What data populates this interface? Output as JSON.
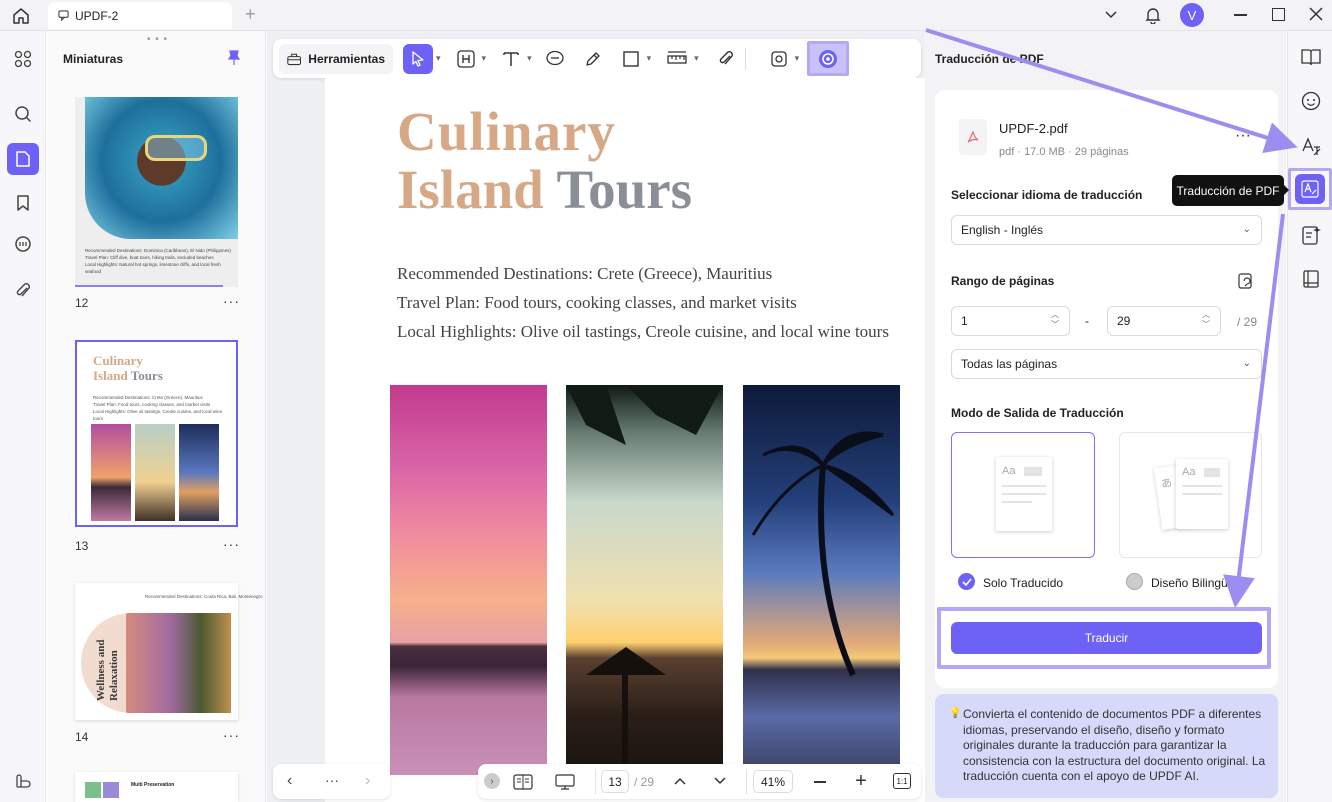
{
  "window": {
    "tab_title": "UPDF-2",
    "user_initial": "V"
  },
  "left_panel": {
    "title": "Miniaturas"
  },
  "thumbnails": [
    {
      "page": "12",
      "lines": [
        "Recommended Destinations: Dominica (Caribbean), El Nido (Philippines)",
        "Travel Plan: Cliff dive, boat tours, hiking trails, secluded beaches",
        "Local Highlights: Natural hot springs, limestone cliffs, and local fresh seafood"
      ]
    },
    {
      "page": "13",
      "title_a": "Culinary",
      "title_b": "Island",
      "title_c": "Tours",
      "lines": [
        "Recommended Destinations: Crete (Greece), Mauritius",
        "Travel Plan: Food tours, cooking classes, and market visits",
        "Local Highlights: Olive oil tastings, Creole cuisine, and local wine tours"
      ]
    },
    {
      "page": "14",
      "header": "Recommended Destinations: Costa Rica, Bali, Montenegro",
      "title_a": "Wellness and",
      "title_b": "Relaxation"
    },
    {
      "title": "Multi Preservation"
    }
  ],
  "toolbar": {
    "tools_label": "Herramientas"
  },
  "document": {
    "title_line1": "Culinary",
    "title_line2_a": "Island",
    "title_line2_b": "Tours",
    "lines": [
      "Recommended Destinations: Crete (Greece), Mauritius",
      "Travel Plan: Food tours, cooking classes, and market visits",
      "Local Highlights: Olive oil tastings, Creole cuisine, and local wine tours"
    ]
  },
  "bottom_bar": {
    "page_current": "13",
    "page_total": "/ 29",
    "zoom": "41%",
    "more": "···",
    "fit_label": "1:1"
  },
  "translation_panel": {
    "title": "Traducción de PDF",
    "file_name": "UPDF-2.pdf",
    "file_meta": "pdf · 17.0 MB · 29 páginas",
    "language_label": "Seleccionar idioma de traducción",
    "language_value": "English - Inglés",
    "range_label": "Rango de páginas",
    "range_from": "1",
    "range_dash": "-",
    "range_to": "29",
    "range_total": "/ 29",
    "range_select": "Todas las páginas",
    "output_label": "Modo de Salida de Traducción",
    "option_only": "Solo Traducido",
    "option_bilingual": "Diseño Bilingü",
    "translate_button": "Traducir",
    "info_text": "Convierta el contenido de documentos PDF a diferentes idiomas, preservando el diseño, diseño y formato originales durante la traducción para garantizar la consistencia con la estructura del documento original. La traducción cuenta con el apoyo de UPDF AI."
  },
  "tooltip": {
    "text": "Traducción de PDF"
  },
  "colors": {
    "accent": "#6e62f6",
    "highlight": "#b4a8f4",
    "info_bg": "#d7d9fb",
    "title_tan": "#d6a886",
    "title_gray": "#8a8f97"
  }
}
